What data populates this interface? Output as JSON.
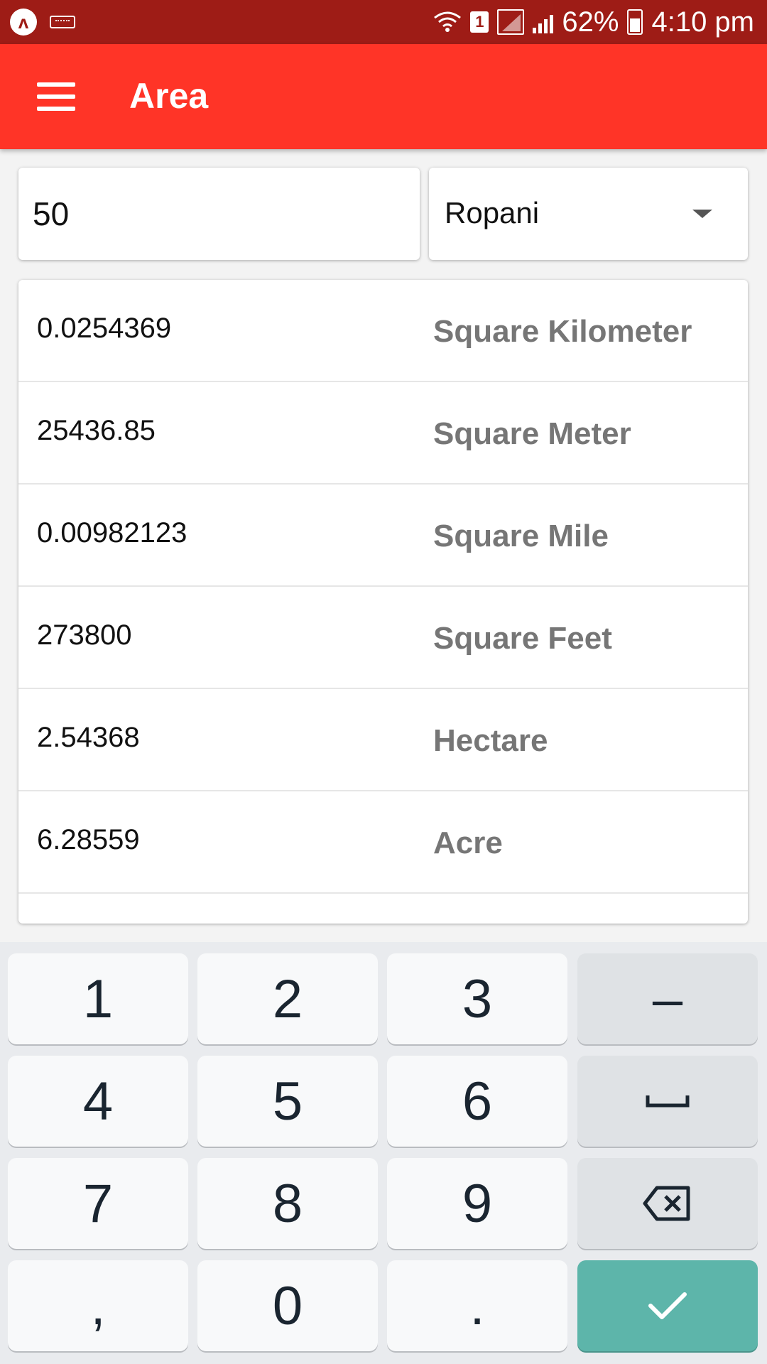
{
  "status_bar": {
    "battery_percent": "62%",
    "time": "4:10 pm",
    "sim_slot": "1",
    "app_icon_label": "ʌ"
  },
  "app_bar": {
    "title": "Area"
  },
  "converter": {
    "input_value": "50",
    "selected_unit": "Ropani"
  },
  "results": [
    {
      "value": "0.0254369",
      "unit": "Square Kilometer"
    },
    {
      "value": "25436.85",
      "unit": "Square Meter"
    },
    {
      "value": "0.00982123",
      "unit": "Square Mile"
    },
    {
      "value": "273800",
      "unit": "Square Feet"
    },
    {
      "value": "2.54368",
      "unit": "Hectare"
    },
    {
      "value": "6.28559",
      "unit": "Acre"
    }
  ],
  "keypad": {
    "k1": "1",
    "k2": "2",
    "k3": "3",
    "minus": "–",
    "k4": "4",
    "k5": "5",
    "k6": "6",
    "space": "␣",
    "k7": "7",
    "k8": "8",
    "k9": "9",
    "comma": ",",
    "k0": "0",
    "dot": "."
  },
  "colors": {
    "status_bar": "#9e1c16",
    "app_bar": "#ff3427",
    "enter_key": "#5db5aa"
  },
  "icons": {
    "menu": "hamburger-icon",
    "dropdown": "caret-down-icon",
    "backspace": "backspace-icon",
    "enter": "checkmark-icon"
  }
}
